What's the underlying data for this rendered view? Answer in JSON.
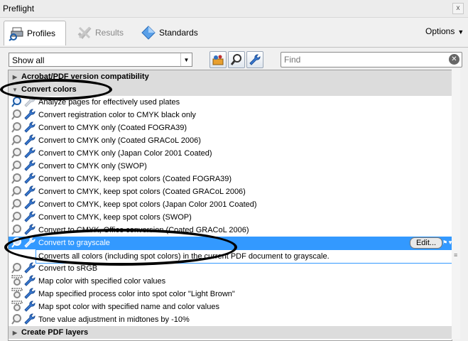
{
  "window": {
    "title": "Preflight",
    "close_glyph": "x"
  },
  "tabs": [
    {
      "label": "Profiles",
      "icon": "profiles-icon",
      "active": true
    },
    {
      "label": "Results",
      "icon": "results-icon",
      "active": false
    },
    {
      "label": "Standards",
      "icon": "standards-icon",
      "active": false
    }
  ],
  "options": {
    "label": "Options"
  },
  "toolbar": {
    "filter_value": "Show all",
    "find_placeholder": "Find"
  },
  "list": {
    "categories": [
      {
        "label": "Acrobat/PDF version compatibility",
        "expanded": false
      },
      {
        "label": "Convert colors",
        "expanded": true
      },
      {
        "label": "Create PDF layers",
        "expanded": false
      }
    ],
    "items": [
      "Analyze pages for effectively used plates",
      "Convert registration color to CMYK black only",
      "Convert to CMYK only (Coated FOGRA39)",
      "Convert to CMYK only (Coated GRACoL 2006)",
      "Convert to CMYK only (Japan Color 2001 Coated)",
      "Convert to CMYK only (SWOP)",
      "Convert to CMYK, keep spot colors (Coated FOGRA39)",
      "Convert to CMYK, keep spot colors (Coated GRACoL 2006)",
      "Convert to CMYK, keep spot colors (Japan Color 2001 Coated)",
      "Convert to CMYK, keep spot colors (SWOP)",
      "Convert to CMYK, Office conversion (Coated GRACoL 2006)",
      "Convert to grayscale",
      "Convert to sRGB",
      "Map color with specified color values",
      "Map specified process color into spot color \"Light Brown\"",
      "Map spot color with specified name and color values",
      "Tone value adjustment in midtones by -10%"
    ],
    "selected": {
      "label": "Convert to grayscale",
      "edit_label": "Edit...",
      "description": "Converts all colors (including spot colors) in the current PDF document to grayscale."
    }
  },
  "colors": {
    "selection": "#3399ff",
    "category_bg": "#dcdcdc",
    "annotation": "#000000"
  }
}
